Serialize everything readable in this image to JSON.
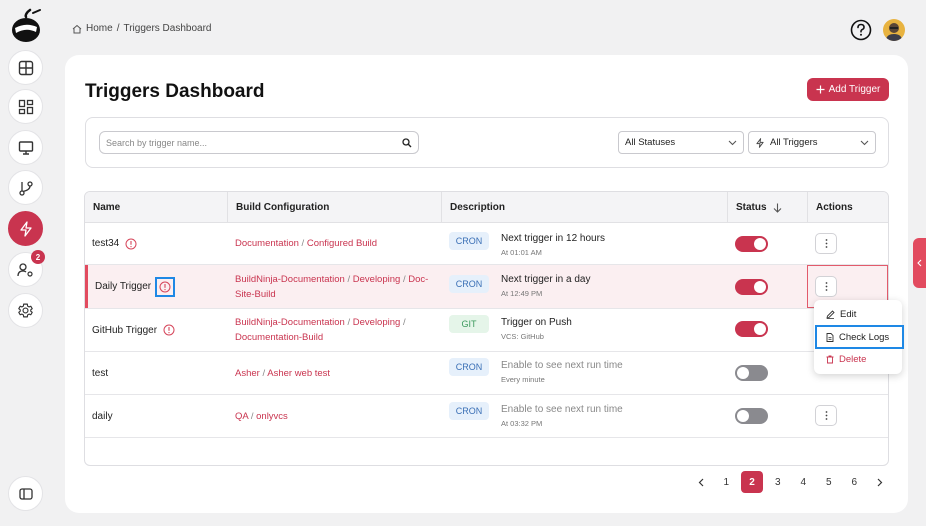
{
  "breadcrumb": {
    "home": "Home",
    "separator": "/",
    "current": "Triggers Dashboard"
  },
  "sidebar": {
    "items": [
      {
        "name": "dashboard",
        "icon": "layout-icon"
      },
      {
        "name": "widgets",
        "icon": "grid-icon"
      },
      {
        "name": "monitor",
        "icon": "monitor-icon"
      },
      {
        "name": "version-control",
        "icon": "git-branch-icon"
      },
      {
        "name": "triggers",
        "icon": "lightning-icon",
        "active": true
      },
      {
        "name": "users",
        "icon": "user-settings-icon",
        "badge": "2"
      },
      {
        "name": "settings",
        "icon": "gear-icon"
      }
    ],
    "collapse_icon": "sidebar-toggle-icon"
  },
  "page": {
    "title": "Triggers Dashboard",
    "add_button": "Add Trigger"
  },
  "filters": {
    "search_placeholder": "Search by trigger name...",
    "status_select": "All Statuses",
    "type_select": "All Triggers"
  },
  "table": {
    "headers": {
      "name": "Name",
      "build": "Build Configuration",
      "description": "Description",
      "status": "Status",
      "actions": "Actions"
    },
    "rows": [
      {
        "name": "test34",
        "build_parts": [
          "Documentation",
          "Configured Build"
        ],
        "tag": "CRON",
        "desc": "Next trigger in 12 hours",
        "sub": "At 01:01 AM",
        "enabled": true
      },
      {
        "name": "Daily Trigger",
        "build_parts": [
          "BuildNinja-Documentation",
          "Developing",
          "Doc-Site-Build"
        ],
        "tag": "CRON",
        "desc": "Next trigger in a day",
        "sub": "At 12:49 PM",
        "enabled": true
      },
      {
        "name": "GitHub Trigger",
        "build_parts": [
          "BuildNinja-Documentation",
          "Developing",
          "Documentation-Build"
        ],
        "tag": "GIT",
        "desc": "Trigger on Push",
        "sub": "VCS: GitHub",
        "enabled": true
      },
      {
        "name": "test",
        "build_parts": [
          "Asher",
          "Asher web test"
        ],
        "tag": "CRON",
        "desc": "Enable to see next run time",
        "sub": "Every minute",
        "enabled": false
      },
      {
        "name": "daily",
        "build_parts": [
          "QA",
          "onlyvcs"
        ],
        "tag": "CRON",
        "desc": "Enable to see next run time",
        "sub": "At 03:32 PM",
        "enabled": false
      }
    ]
  },
  "menu": {
    "edit": "Edit",
    "check_logs": "Check Logs",
    "delete": "Delete"
  },
  "pagination": {
    "pages": [
      "1",
      "2",
      "3",
      "4",
      "5",
      "6"
    ],
    "current": "2"
  },
  "colors": {
    "accent": "#c9344f",
    "highlight": "#1e88e5"
  }
}
